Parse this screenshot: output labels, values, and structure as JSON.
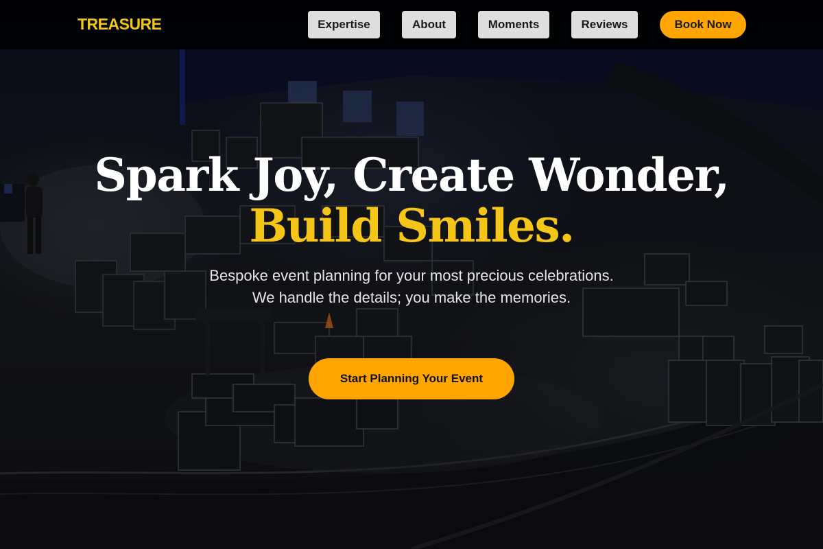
{
  "brand": {
    "name": "TREASURE",
    "accent": "#f5c518",
    "cta_color": "#ffa500"
  },
  "nav": {
    "items": [
      {
        "label": "Expertise"
      },
      {
        "label": "About"
      },
      {
        "label": "Moments"
      },
      {
        "label": "Reviews"
      }
    ],
    "book_label": "Book Now"
  },
  "hero": {
    "headline_line1": "Spark Joy, Create Wonder,",
    "headline_line2": "Build Smiles.",
    "subtitle": "Bespoke event planning for your most precious celebrations. We handle the details; you make the memories.",
    "cta_label": "Start Planning Your Event",
    "background": "dark arena stage with equipment road cases"
  }
}
